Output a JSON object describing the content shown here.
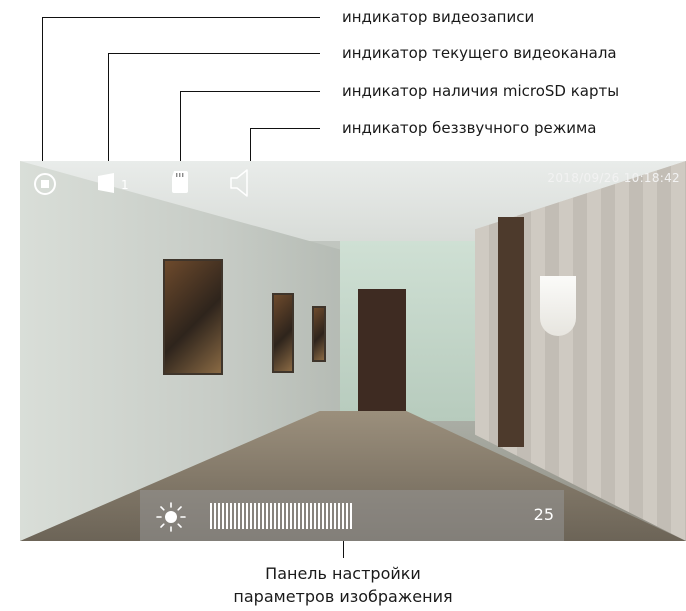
{
  "annotations": {
    "rec": "индикатор видеозаписи",
    "channel": "индикатор текущего видеоканала",
    "sd": "индикатор наличия microSD карты",
    "mute": "индикатор беззвучного режима"
  },
  "screen": {
    "channel_number": "1",
    "datetime": "2018/09/26  10:18:42",
    "panel": {
      "value": "25",
      "level_fraction": 0.55,
      "icon": "brightness-sun-icon"
    }
  },
  "bottom_label": {
    "line1": "Панель настройки",
    "line2": "параметров изображения"
  },
  "colors": {
    "overlay_text": "#ffffff",
    "annotation_text": "#1a1a1a"
  }
}
